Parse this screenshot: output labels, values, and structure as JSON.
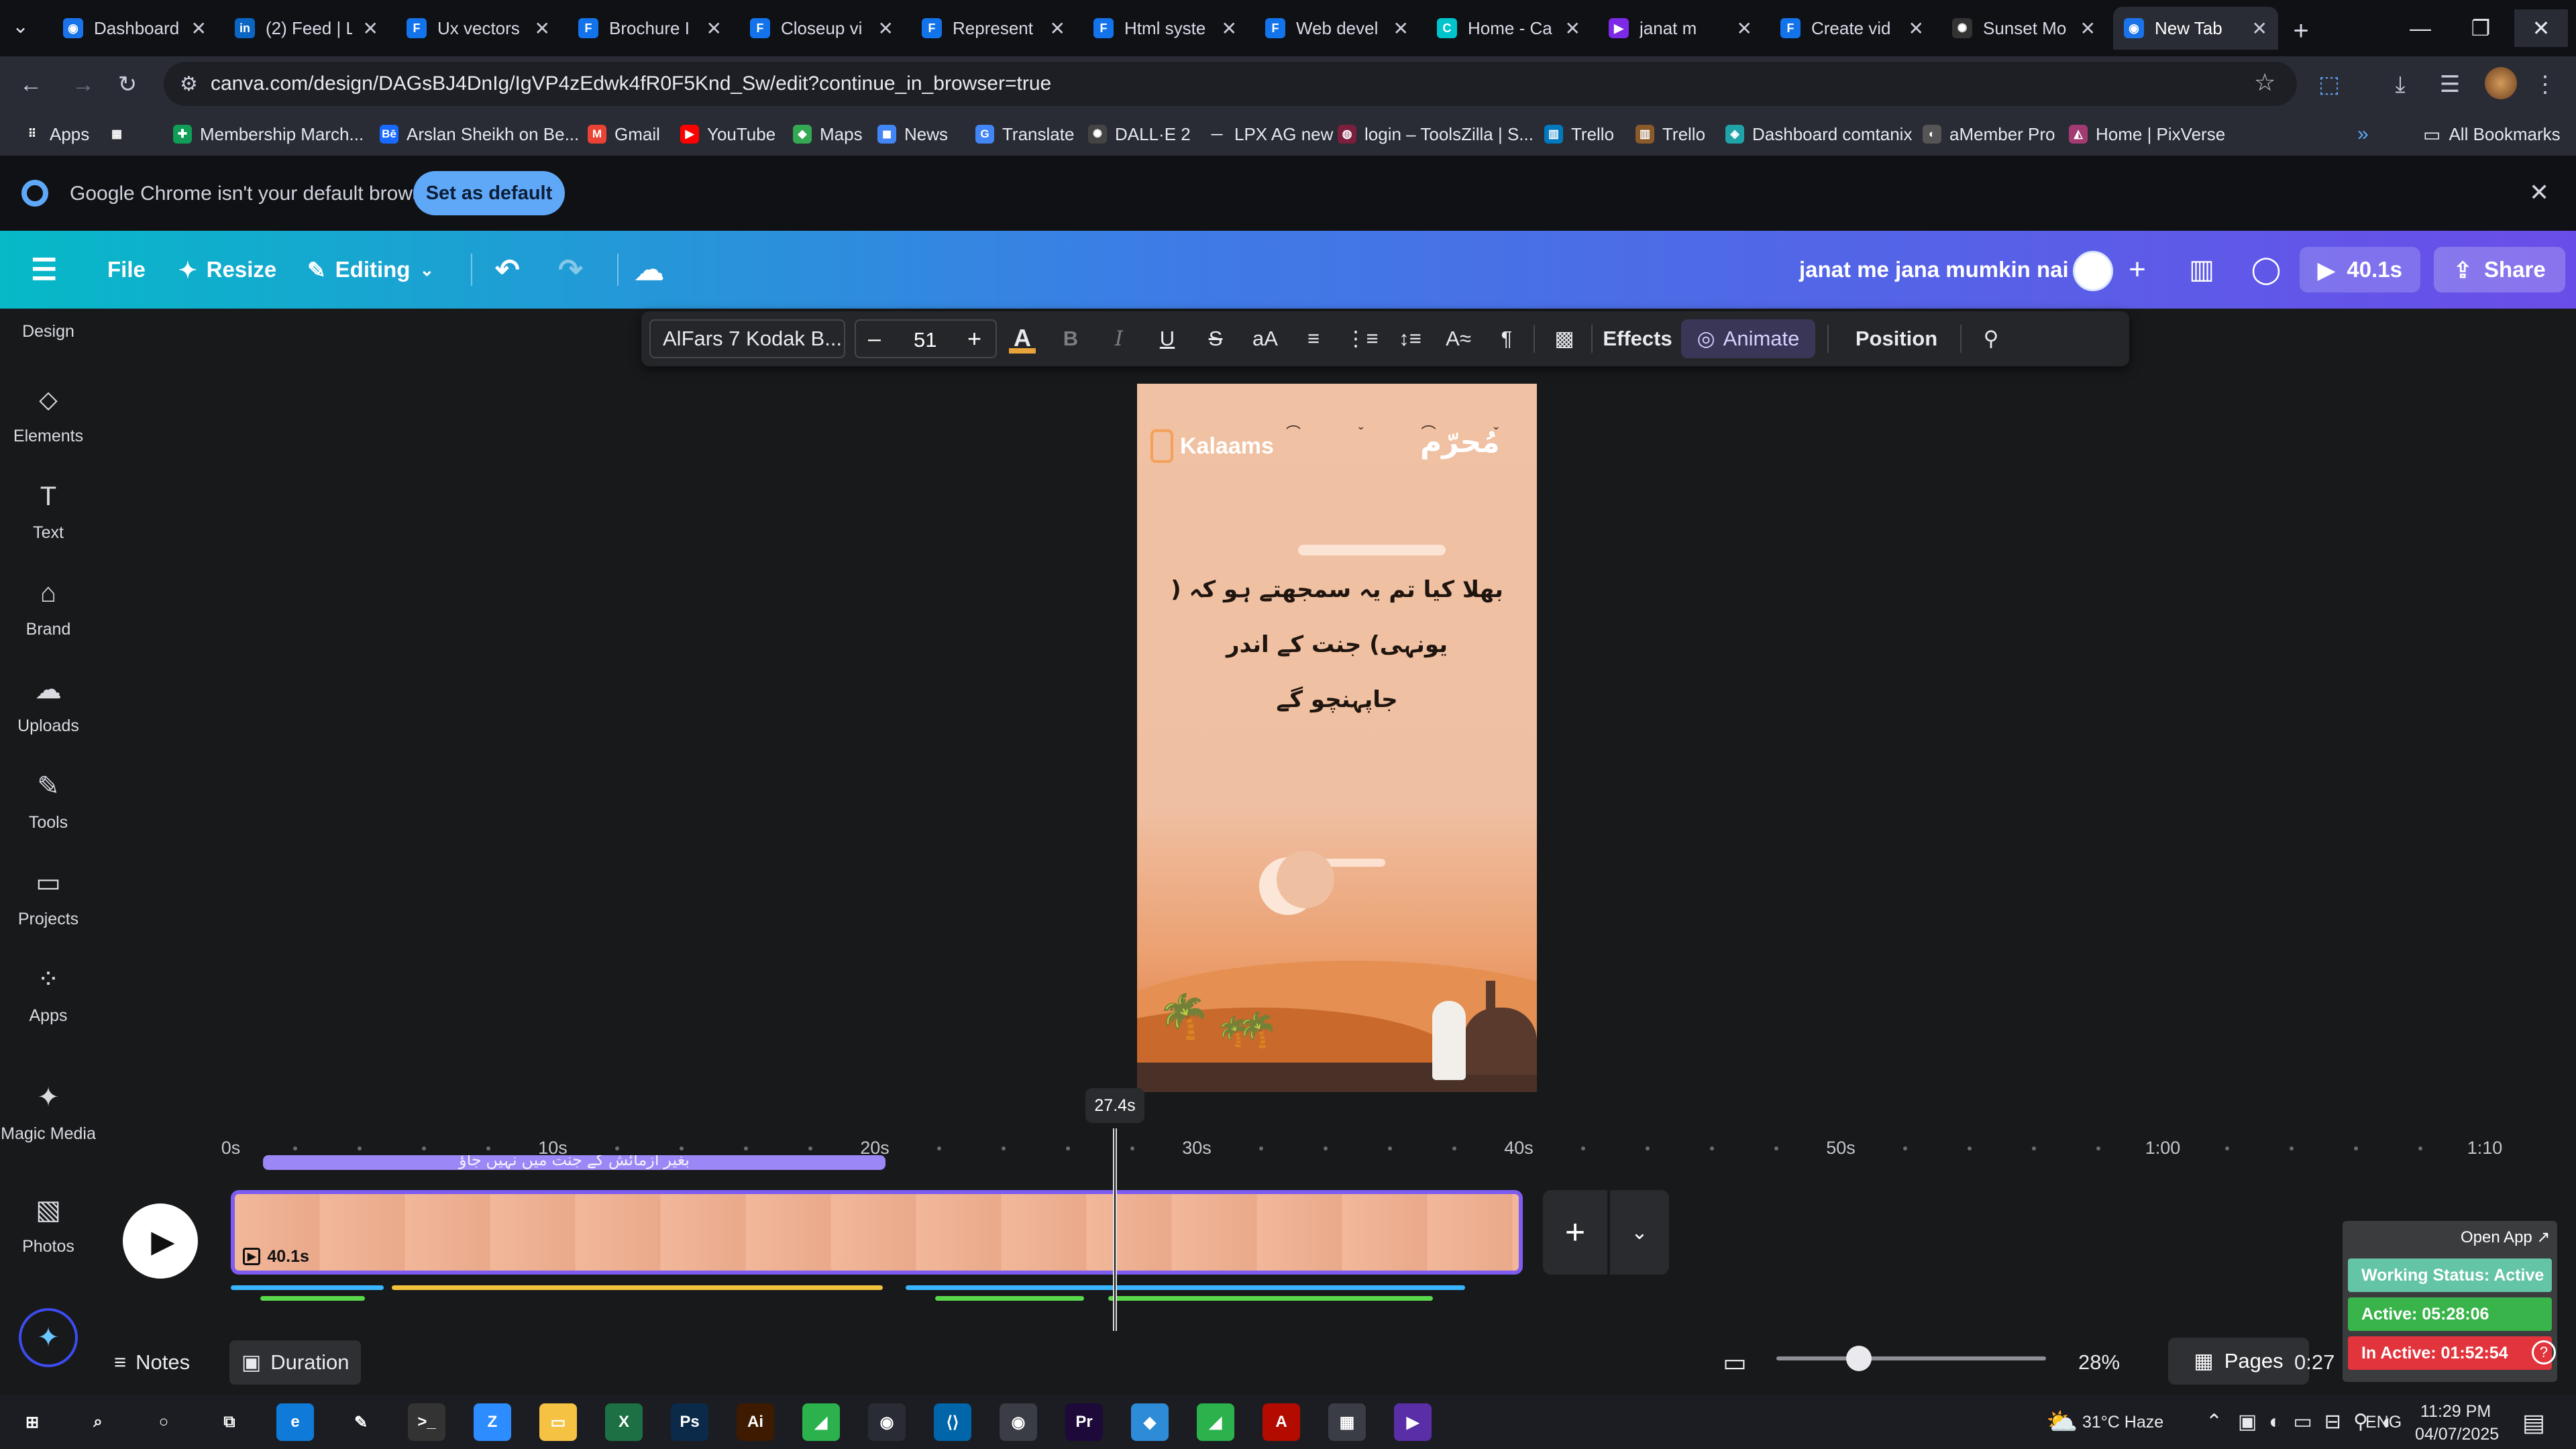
{
  "browser": {
    "tabs": [
      {
        "title": "Dashboard",
        "icon": "chrome-tab-icon",
        "color": "#1a73e8",
        "glyph": "◉"
      },
      {
        "title": "(2) Feed | L",
        "icon": "linkedin-icon",
        "color": "#0a66c2",
        "glyph": "in"
      },
      {
        "title": "Ux vectors",
        "icon": "freepik-icon",
        "color": "#1273eb",
        "glyph": "F"
      },
      {
        "title": "Brochure I",
        "icon": "freepik-icon",
        "color": "#1273eb",
        "glyph": "F"
      },
      {
        "title": "Closeup vi",
        "icon": "freepik-icon",
        "color": "#1273eb",
        "glyph": "F"
      },
      {
        "title": "Represent",
        "icon": "freepik-icon",
        "color": "#1273eb",
        "glyph": "F"
      },
      {
        "title": "Html syste",
        "icon": "freepik-icon",
        "color": "#1273eb",
        "glyph": "F"
      },
      {
        "title": "Web devel",
        "icon": "freepik-icon",
        "color": "#1273eb",
        "glyph": "F"
      },
      {
        "title": "Home - Ca",
        "icon": "canva-icon",
        "color": "#00c4cc",
        "glyph": "C"
      },
      {
        "title": "janat m",
        "icon": "canva-video-icon",
        "color": "#7d2ae8",
        "glyph": "▶"
      },
      {
        "title": "Create vid",
        "icon": "freepik-icon",
        "color": "#1273eb",
        "glyph": "F"
      },
      {
        "title": "Sunset Mo",
        "icon": "openai-icon",
        "color": "#333333",
        "glyph": "✺"
      },
      {
        "title": "New Tab",
        "icon": "chrome-tab-icon",
        "color": "#1a73e8",
        "glyph": "◉"
      }
    ],
    "url": "canva.com/design/DAGsBJ4DnIg/IgVP4zEdwk4fR0F5Knd_Sw/edit?continue_in_browser=true",
    "bookmarks": [
      {
        "label": "Apps",
        "icon": "apps-grid-icon",
        "color": "#2a2c35",
        "glyph": "⠿"
      },
      {
        "label": "",
        "icon": "google-apps-icon",
        "color": "#2a2c35",
        "glyph": "▦"
      },
      {
        "label": "Membership March...",
        "icon": "green-bookmark-icon",
        "color": "#0f9d58",
        "glyph": "✚"
      },
      {
        "label": "Arslan Sheikh on Be...",
        "icon": "behance-icon",
        "color": "#1769ff",
        "glyph": "Bē"
      },
      {
        "label": "Gmail",
        "icon": "gmail-icon",
        "color": "#ea4335",
        "glyph": "M"
      },
      {
        "label": "YouTube",
        "icon": "youtube-icon",
        "color": "#ff0000",
        "glyph": "▶"
      },
      {
        "label": "Maps",
        "icon": "maps-icon",
        "color": "#34a853",
        "glyph": "◆"
      },
      {
        "label": "News",
        "icon": "news-icon",
        "color": "#4285f4",
        "glyph": "◼"
      },
      {
        "label": "Translate",
        "icon": "translate-icon",
        "color": "#4285f4",
        "glyph": "G"
      },
      {
        "label": "DALL·E 2",
        "icon": "openai-icon",
        "color": "#444444",
        "glyph": "✺"
      },
      {
        "label": "LPX AG new",
        "icon": "lpx-icon",
        "color": "#2a2c35",
        "glyph": "—"
      },
      {
        "label": "login – ToolsZilla | S...",
        "icon": "toolszilla-icon",
        "color": "#7a1f3d",
        "glyph": "◍"
      },
      {
        "label": "Trello",
        "icon": "trello-icon",
        "color": "#0079bf",
        "glyph": "▥"
      },
      {
        "label": "Trello",
        "icon": "trello-icon",
        "color": "#8b5a2b",
        "glyph": "▥"
      },
      {
        "label": "Dashboard comtanix",
        "icon": "comtanix-icon",
        "color": "#1fa2a8",
        "glyph": "◈"
      },
      {
        "label": "aMember Pro",
        "icon": "amember-icon",
        "color": "#555555",
        "glyph": "◐"
      },
      {
        "label": "Home | PixVerse",
        "icon": "pixverse-icon",
        "color": "#a23b72",
        "glyph": "◭"
      }
    ],
    "all_bookmarks": "All Bookmarks",
    "infobar": {
      "message": "Google Chrome isn't your default browser",
      "button": "Set as default"
    }
  },
  "canva": {
    "header": {
      "menu_icon": "hamburger-icon",
      "file": "File",
      "resize": "Resize",
      "editing": "Editing",
      "design_title": "janat me jana mumkin nai",
      "play_label": "40.1s",
      "share_label": "Share"
    },
    "sidebar": [
      {
        "label": "Design",
        "icon": "design-icon"
      },
      {
        "label": "Elements",
        "icon": "elements-icon"
      },
      {
        "label": "Text",
        "icon": "text-icon"
      },
      {
        "label": "Brand",
        "icon": "brand-icon"
      },
      {
        "label": "Uploads",
        "icon": "uploads-icon"
      },
      {
        "label": "Tools",
        "icon": "tools-icon"
      },
      {
        "label": "Projects",
        "icon": "projects-icon"
      },
      {
        "label": "Apps",
        "icon": "apps-icon"
      },
      {
        "label": "Magic Media",
        "icon": "magic-media-icon"
      },
      {
        "label": "Photos",
        "icon": "photos-icon"
      }
    ],
    "toolbar": {
      "font": "AlFars 7 Kodak B...",
      "font_size": "51",
      "minus": "–",
      "plus": "+",
      "effects": "Effects",
      "animate": "Animate",
      "position": "Position",
      "case": "aA",
      "text_color": "#e8a33a"
    },
    "design": {
      "brand_name": "Kalaams",
      "logo_urdu": "مُحرّم",
      "quote_line1": "بھلا کیا تم یہ سمجھتے ہو کہ ( یونہی) جنت کے اندر",
      "quote_line2": "جاپہنچو گے"
    },
    "timeline": {
      "ticks": [
        "0s",
        "10s",
        "20s",
        "30s",
        "40s",
        "50s",
        "1:00",
        "1:10"
      ],
      "playhead_time": "27.4s",
      "audio_label": "بغیر آزمائش کے جنت میں نہیں جاؤ",
      "clip_duration": "40.1s",
      "notes": "Notes",
      "duration": "Duration",
      "zoom": "28%",
      "pages": "Pages",
      "time_readout": "0:27"
    },
    "status_widget": {
      "open_app": "Open App ↗",
      "working_status": "Working Status: Active",
      "active": "Active: 05:28:06",
      "inactive": "In Active: 01:52:54"
    }
  },
  "taskbar": {
    "apps": [
      {
        "name": "windows-start-icon",
        "color": "#1c1d22",
        "glyph": "⊞"
      },
      {
        "name": "search-icon",
        "color": "#1c1d22",
        "glyph": "⌕"
      },
      {
        "name": "cortana-icon",
        "color": "#1c1d22",
        "glyph": "○"
      },
      {
        "name": "task-view-icon",
        "color": "#1c1d22",
        "glyph": "⧉"
      },
      {
        "name": "edge-icon",
        "color": "#0f7ad8",
        "glyph": "e"
      },
      {
        "name": "pen-app-icon",
        "color": "#1c1d22",
        "glyph": "✎"
      },
      {
        "name": "terminal-icon",
        "color": "#333333",
        "glyph": ">_"
      },
      {
        "name": "zoom-icon",
        "color": "#2d8cff",
        "glyph": "Z"
      },
      {
        "name": "file-explorer-icon",
        "color": "#f5c243",
        "glyph": "▭"
      },
      {
        "name": "excel-icon",
        "color": "#1d7044",
        "glyph": "X"
      },
      {
        "name": "photoshop-icon",
        "color": "#0b2a4a",
        "glyph": "Ps"
      },
      {
        "name": "illustrator-icon",
        "color": "#3d1a00",
        "glyph": "Ai"
      },
      {
        "name": "green-app-icon",
        "color": "#2bb24c",
        "glyph": "◢"
      },
      {
        "name": "chrome-icon",
        "color": "#2a2c35",
        "glyph": "◉"
      },
      {
        "name": "vscode-icon",
        "color": "#0065a9",
        "glyph": "⟨⟩"
      },
      {
        "name": "chrome-active-icon",
        "color": "#3a3c46",
        "glyph": "◉"
      },
      {
        "name": "premiere-icon",
        "color": "#1d0a3a",
        "glyph": "Pr"
      },
      {
        "name": "blue-app-icon",
        "color": "#2e8bd8",
        "glyph": "◆"
      },
      {
        "name": "green-app-2-icon",
        "color": "#2bb24c",
        "glyph": "◢"
      },
      {
        "name": "acrobat-icon",
        "color": "#b30b00",
        "glyph": "A"
      },
      {
        "name": "calculator-icon",
        "color": "#3a3c46",
        "glyph": "▦"
      },
      {
        "name": "media-player-icon",
        "color": "#5a2ea6",
        "glyph": "▶"
      }
    ],
    "weather": "31°C Haze",
    "language": "ENG",
    "time": "11:29 PM",
    "date": "04/07/2025"
  }
}
